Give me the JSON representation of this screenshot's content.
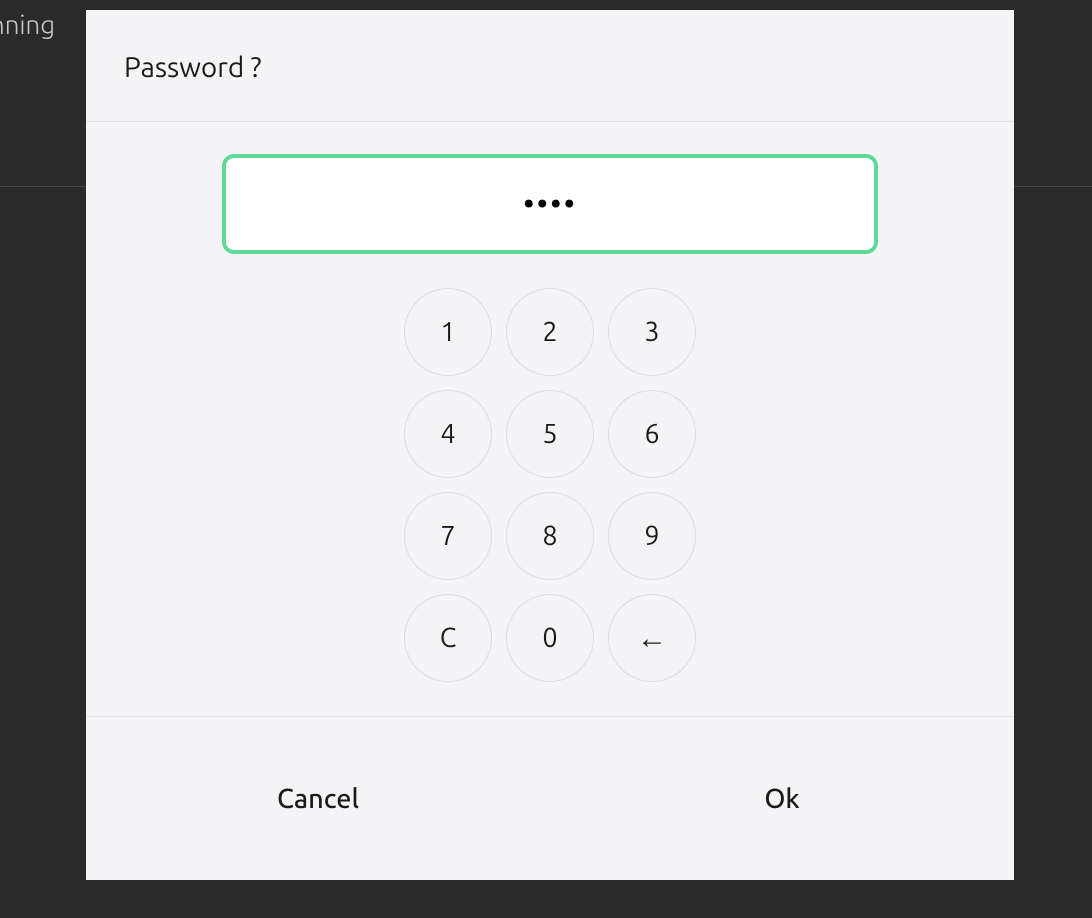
{
  "background": {
    "text_fragment": "nning"
  },
  "dialog": {
    "title": "Password ?",
    "input_value": "••••",
    "keypad": {
      "keys": [
        "1",
        "2",
        "3",
        "4",
        "5",
        "6",
        "7",
        "8",
        "9"
      ],
      "clear": "C",
      "zero": "0",
      "backspace": "←"
    },
    "footer": {
      "cancel": "Cancel",
      "ok": "Ok"
    }
  }
}
